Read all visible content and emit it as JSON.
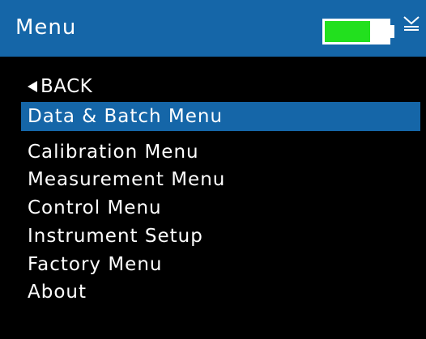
{
  "header": {
    "title": "Menu",
    "battery_level": 0.72,
    "usb_icon": "usb-connected-icon"
  },
  "menu": {
    "back_label": "BACK",
    "items": [
      {
        "label": "Data & Batch Menu",
        "selected": true
      },
      {
        "label": "Calibration Menu",
        "selected": false
      },
      {
        "label": "Measurement Menu",
        "selected": false
      },
      {
        "label": "Control Menu",
        "selected": false
      },
      {
        "label": "Instrument Setup",
        "selected": false
      },
      {
        "label": "Factory Menu",
        "selected": false
      },
      {
        "label": "About",
        "selected": false
      }
    ]
  },
  "colors": {
    "header_bg": "#1566a8",
    "screen_bg": "#000000",
    "selected_bg": "#1566a8",
    "battery_fill": "#22e01e",
    "text": "#ffffff"
  }
}
